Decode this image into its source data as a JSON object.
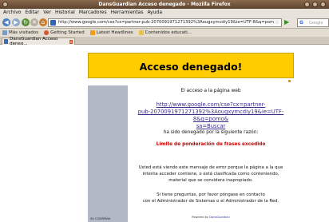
{
  "window": {
    "title": "DansGuardian Acceso denegado - Mozilla Firefox"
  },
  "menu": [
    "Archivo",
    "Editar",
    "Ver",
    "Historial",
    "Marcadores",
    "Herramientas",
    "Ayuda"
  ],
  "nav": {
    "url": "http://www.google.com/cse?cx=partner-pub-2070091971271392%3Aougxymcdiy19&ie=UTF-8&q=pomo&sa=1",
    "search_placeholder": "Google"
  },
  "bookmarks": [
    "Más visitados",
    "Getting Started",
    "Latest Headlines",
    "Contenidos educati..."
  ],
  "tab": {
    "label": "DansGuardian Acceso deneg..."
  },
  "page": {
    "heading": "Acceso denegado!",
    "intro": "El acceso a la página web",
    "blocked_url_lines": [
      "http://www.google.com/cse?cx=partner-",
      "pub-2070091971271392%3Aougxymcdiy19&ie=UTF-8&q=pomo&",
      "sa=Buscar"
    ],
    "denied_text": "ha sido denegado por la siguiente razón:",
    "reason": "Límite de ponderación de frases excedido",
    "info_lines": [
      "Usted está viendo este mensaje de error porque la página a la que",
      "intenta acceder contiene, o está clasificada como conteniendo,",
      "material que se considera inapropiado."
    ],
    "contact_lines": [
      "Si tiene preguntas, por favor póngase en contacto",
      "con el Administrador de Sistemas o el Administrador de la Red."
    ],
    "powered_prefix": "Powered by",
    "powered_link": "DansGuardian",
    "left_footer": "SU COMPAÑIA"
  },
  "colors": {
    "banner": "#ffcc00",
    "sidebar": "#b1b9c7",
    "reason": "#cc0000",
    "link": "#3b2e86"
  }
}
